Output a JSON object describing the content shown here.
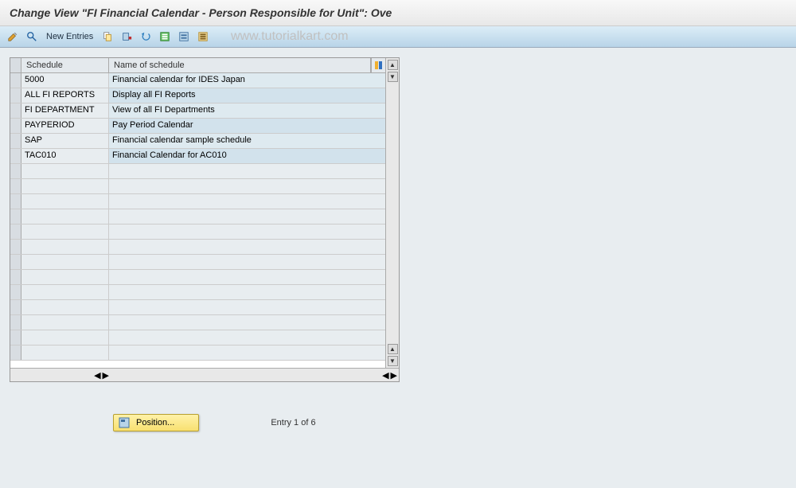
{
  "header": {
    "title": "Change View \"FI Financial Calendar - Person Responsible for Unit\": Ove"
  },
  "toolbar": {
    "new_entries": "New Entries",
    "icons": [
      "change-icon",
      "display-icon",
      "copy-icon",
      "delete-icon",
      "undo-icon",
      "select-all-icon",
      "select-block-icon",
      "deselect-icon"
    ]
  },
  "watermark": "www.tutorialkart.com",
  "table": {
    "columns": {
      "schedule": "Schedule",
      "name": "Name of schedule"
    },
    "rows": [
      {
        "schedule": "5000",
        "name": "Financial calendar for IDES Japan"
      },
      {
        "schedule": "ALL FI REPORTS",
        "name": "Display all FI Reports"
      },
      {
        "schedule": "FI DEPARTMENT",
        "name": "View of all FI Departments"
      },
      {
        "schedule": "PAYPERIOD",
        "name": "Pay Period Calendar"
      },
      {
        "schedule": "SAP",
        "name": "Financial calendar sample schedule"
      },
      {
        "schedule": "TAC010",
        "name": "Financial Calendar for AC010"
      }
    ],
    "empty_rows": 13
  },
  "footer": {
    "position_label": "Position...",
    "entry_count": "Entry 1 of 6"
  }
}
